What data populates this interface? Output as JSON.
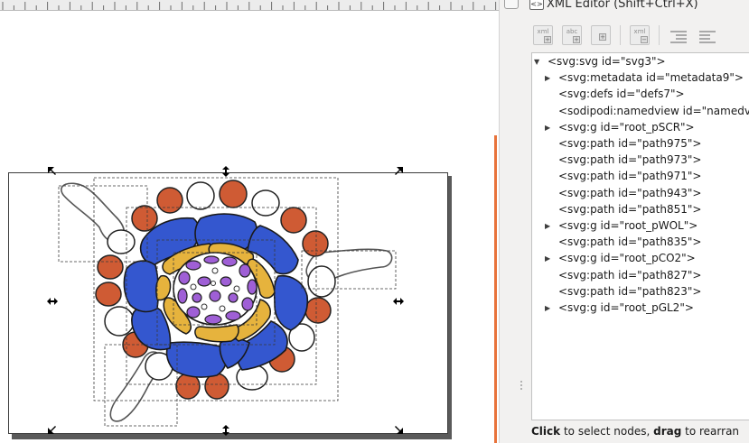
{
  "xml_editor": {
    "title": "XML Editor (Shift+Ctrl+X)",
    "panel_icon": "<>",
    "toolbar": [
      {
        "name": "new-element-node-button",
        "icon": "xml-element-plus-icon",
        "label": "xml"
      },
      {
        "name": "new-text-node-button",
        "icon": "xml-text-plus-icon",
        "label": "abc"
      },
      {
        "name": "duplicate-node-button",
        "icon": "duplicate-node-icon",
        "label": ""
      },
      {
        "name": "delete-node-button",
        "icon": "xml-delete-icon",
        "label": "xml"
      },
      {
        "name": "unindent-node-button",
        "icon": "unindent-icon",
        "label": ""
      },
      {
        "name": "indent-node-button",
        "icon": "indent-icon",
        "label": ""
      }
    ],
    "tree": [
      {
        "label": "<svg:svg id=\"svg3\">",
        "depth": 0,
        "expander": "expanded"
      },
      {
        "label": "<svg:metadata id=\"metadata9\">",
        "depth": 1,
        "expander": "collapsed"
      },
      {
        "label": "<svg:defs id=\"defs7\">",
        "depth": 1,
        "expander": "none"
      },
      {
        "label": "<sodipodi:namedview id=\"namedv",
        "depth": 1,
        "expander": "none"
      },
      {
        "label": "<svg:g id=\"root_pSCR\">",
        "depth": 1,
        "expander": "collapsed"
      },
      {
        "label": "<svg:path id=\"path975\">",
        "depth": 1,
        "expander": "none"
      },
      {
        "label": "<svg:path id=\"path973\">",
        "depth": 1,
        "expander": "none"
      },
      {
        "label": "<svg:path id=\"path971\">",
        "depth": 1,
        "expander": "none"
      },
      {
        "label": "<svg:path id=\"path943\">",
        "depth": 1,
        "expander": "none"
      },
      {
        "label": "<svg:path id=\"path851\">",
        "depth": 1,
        "expander": "none"
      },
      {
        "label": "<svg:g id=\"root_pWOL\">",
        "depth": 1,
        "expander": "collapsed"
      },
      {
        "label": "<svg:path id=\"path835\">",
        "depth": 1,
        "expander": "none"
      },
      {
        "label": "<svg:g id=\"root_pCO2\">",
        "depth": 1,
        "expander": "collapsed"
      },
      {
        "label": "<svg:path id=\"path827\">",
        "depth": 1,
        "expander": "none"
      },
      {
        "label": "<svg:path id=\"path823\">",
        "depth": 1,
        "expander": "none"
      },
      {
        "label": "<svg:g id=\"root_pGL2\">",
        "depth": 1,
        "expander": "collapsed"
      }
    ],
    "status": {
      "bold1": "Click",
      "text1": " to select nodes, ",
      "bold2": "drag",
      "text2": " to rearran"
    }
  },
  "colors": {
    "epidermis": "#cf5b34",
    "cortex": "#3457cf",
    "endodermis": "#e6b33d",
    "stele": "#9f5fd6",
    "accent_scroll": "#e8733b"
  }
}
